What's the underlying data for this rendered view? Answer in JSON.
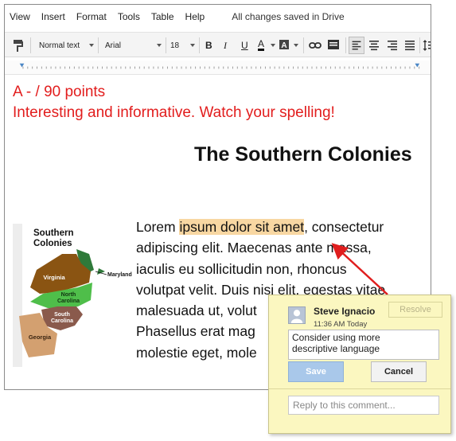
{
  "menu": {
    "items": [
      "View",
      "Insert",
      "Format",
      "Tools",
      "Table",
      "Help"
    ],
    "status": "All changes saved in Drive"
  },
  "toolbar": {
    "style": "Normal text",
    "font": "Arial",
    "size": "18",
    "bold": "B",
    "italic": "I",
    "underline": "U",
    "text_color": "A"
  },
  "document": {
    "grade": "A - / 90 points",
    "feedback": "Interesting and informative. Watch your spelling!",
    "title": "The Southern Colonies",
    "lines": [
      {
        "before": "Lorem ",
        "highlight": "ipsum dolor sit amet",
        "after": ", consectetur"
      },
      {
        "before": "adipiscing elit. Maecenas ante massa,",
        "highlight": "",
        "after": ""
      },
      {
        "before": "iaculis eu sollicitudin non, rhoncus",
        "highlight": "",
        "after": ""
      },
      {
        "before": "volutpat velit. Duis nisi elit, egestas vitae",
        "highlight": "",
        "after": ""
      },
      {
        "before": "malesuada ut, volut",
        "highlight": "",
        "after": ""
      },
      {
        "before": "Phasellus erat mag",
        "highlight": "",
        "after": ""
      },
      {
        "before": "molestie eget, mole",
        "highlight": "",
        "after": ""
      }
    ]
  },
  "map": {
    "title_line1": "Southern",
    "title_line2": "Colonies",
    "labels": {
      "maryland": "Maryland",
      "virginia": "Virginia",
      "north_carolina_1": "North",
      "north_carolina_2": "Carolina",
      "south_carolina_1": "South",
      "south_carolina_2": "Carolina",
      "georgia": "Georgia"
    }
  },
  "comment": {
    "author": "Steve Ignacio",
    "time": "11:36 AM Today",
    "resolve": "Resolve",
    "text": "Consider using more\ndescriptive language",
    "save": "Save",
    "cancel": "Cancel",
    "reply_placeholder": "Reply to this comment..."
  },
  "colors": {
    "feedback_red": "#e21d1d",
    "highlight": "#f8d7a2",
    "comment_bg": "#fbf7c0",
    "save_blue": "#a9c8ea",
    "arrow_red": "#e01e1e"
  }
}
